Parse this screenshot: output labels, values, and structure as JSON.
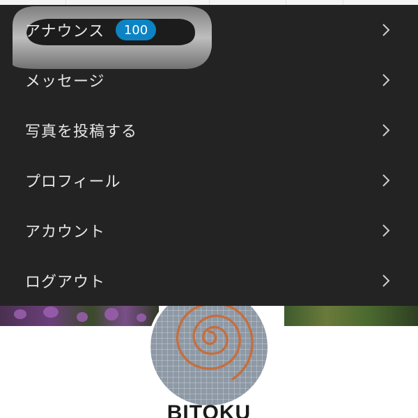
{
  "menu": {
    "items": [
      {
        "label": "アナウンス",
        "badge": "100"
      },
      {
        "label": "メッセージ"
      },
      {
        "label": "写真を投稿する"
      },
      {
        "label": "プロフィール"
      },
      {
        "label": "アカウント"
      },
      {
        "label": "ログアウト"
      }
    ]
  },
  "profile": {
    "username": "BITOKU"
  },
  "colors": {
    "menu_background": "#232323",
    "menu_text": "#e6e6e6",
    "badge_background": "#0d83c4",
    "chevron": "#cfcfcf"
  },
  "icons": {
    "logo": "ring-logo-icon",
    "chevron": "chevron-right-icon",
    "avatar": "copper-spiral-avatar"
  }
}
